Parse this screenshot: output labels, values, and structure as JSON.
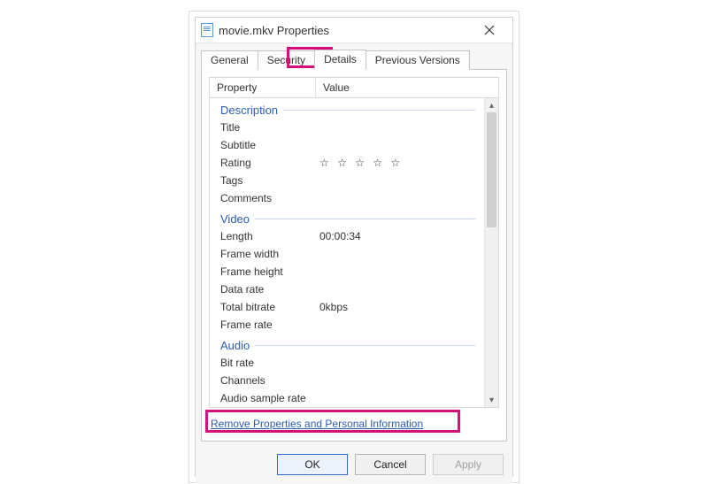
{
  "window": {
    "title": "movie.mkv Properties"
  },
  "tabs": {
    "general": "General",
    "security": "Security",
    "details": "Details",
    "previous": "Previous Versions"
  },
  "columns": {
    "property": "Property",
    "value": "Value"
  },
  "sections": {
    "description": {
      "title": "Description",
      "rows": {
        "title": {
          "k": "Title",
          "v": ""
        },
        "subtitle": {
          "k": "Subtitle",
          "v": ""
        },
        "rating": {
          "k": "Rating",
          "v": "☆ ☆ ☆ ☆ ☆"
        },
        "tags": {
          "k": "Tags",
          "v": ""
        },
        "comments": {
          "k": "Comments",
          "v": ""
        }
      }
    },
    "video": {
      "title": "Video",
      "rows": {
        "length": {
          "k": "Length",
          "v": "00:00:34"
        },
        "frame_width": {
          "k": "Frame width",
          "v": ""
        },
        "frame_height": {
          "k": "Frame height",
          "v": ""
        },
        "data_rate": {
          "k": "Data rate",
          "v": ""
        },
        "total_bitrate": {
          "k": "Total bitrate",
          "v": "0kbps"
        },
        "frame_rate": {
          "k": "Frame rate",
          "v": ""
        }
      }
    },
    "audio": {
      "title": "Audio",
      "rows": {
        "bit_rate": {
          "k": "Bit rate",
          "v": ""
        },
        "channels": {
          "k": "Channels",
          "v": ""
        },
        "audio_sample_rate": {
          "k": "Audio sample rate",
          "v": ""
        }
      }
    }
  },
  "link": {
    "remove": "Remove Properties and Personal Information"
  },
  "buttons": {
    "ok": "OK",
    "cancel": "Cancel",
    "apply": "Apply"
  }
}
